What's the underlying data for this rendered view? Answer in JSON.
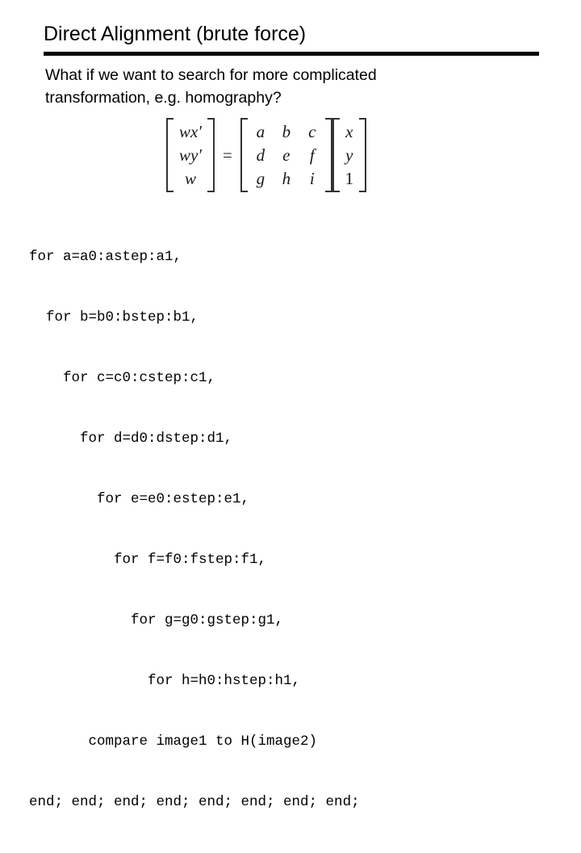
{
  "slide": {
    "title": "Direct Alignment (brute force)",
    "body_lines": [
      "What if we want to search for more complicated",
      "transformation, e.g. homography?"
    ]
  },
  "equation": {
    "left_vector": {
      "rows": [
        "wx′",
        "wy′",
        "w"
      ],
      "plain": [
        "wx'",
        "wy'",
        "w"
      ]
    },
    "equals": "=",
    "matrix3x3": {
      "rows": [
        [
          "a",
          "b",
          "c"
        ],
        [
          "d",
          "e",
          "f"
        ],
        [
          "g",
          "h",
          "i"
        ]
      ]
    },
    "right_vector": {
      "rows": [
        "x",
        "y",
        "1"
      ]
    }
  },
  "code": {
    "lines": [
      "for a=a0:astep:a1,",
      "  for b=b0:bstep:b1,",
      "    for c=c0:cstep:c1,",
      "      for d=d0:dstep:d1,",
      "        for e=e0:estep:e1,",
      "          for f=f0:fstep:f1,",
      "            for g=g0:gstep:g1,",
      "              for h=h0:hstep:h1,",
      "       compare image1 to H(image2)",
      "end; end; end; end; end; end; end; end;"
    ]
  },
  "colors": {
    "background": "#ffffff",
    "text": "#000000",
    "rule": "#000000",
    "equation_ink": "#1a1a1a"
  }
}
